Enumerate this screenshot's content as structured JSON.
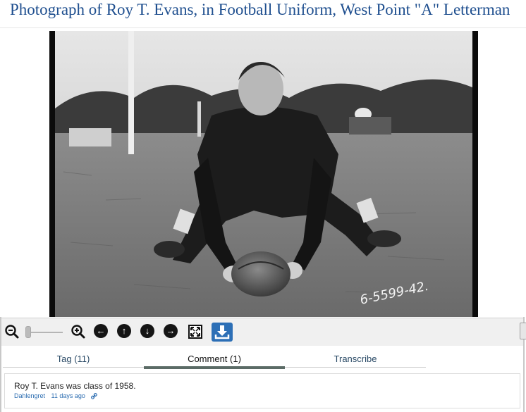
{
  "page": {
    "title": "Photograph of Roy T. Evans, in Football Uniform, West Point \"A\" Letterman"
  },
  "photo": {
    "caption_marking": "6-5599-42."
  },
  "toolbar": {
    "zoom_level": 0.05,
    "icons": [
      "zoom-out-icon",
      "zoom-slider",
      "zoom-in-icon",
      "arrow-left-icon",
      "arrow-up-icon",
      "arrow-down-icon",
      "arrow-right-icon",
      "fullscreen-icon",
      "download-icon"
    ]
  },
  "tabs": [
    {
      "label": "Tag (11)",
      "active": false
    },
    {
      "label": "Comment (1)",
      "active": true
    },
    {
      "label": "Transcribe",
      "active": false
    }
  ],
  "comment": {
    "text": "Roy T. Evans was class of 1958.",
    "author": "Dahlengret",
    "time": "11 days ago"
  },
  "colors": {
    "title": "#1f4f8f",
    "download_button": "#2c6fb6",
    "active_tab_bar": "#5b6b66",
    "link": "#2b6cb0"
  }
}
